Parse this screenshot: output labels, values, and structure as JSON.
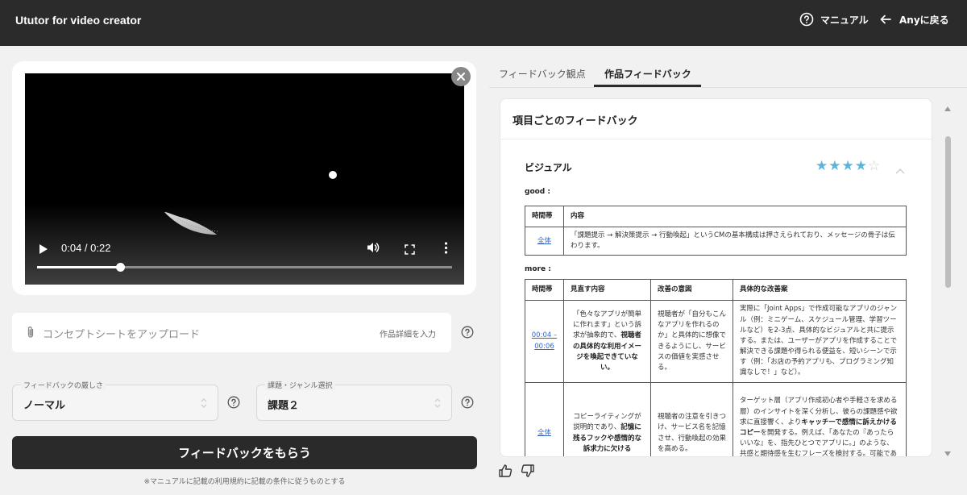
{
  "header": {
    "app_title": "Ututor for video creator",
    "manual_label": "マニュアル",
    "back_label": "Anyに戻る",
    "help_icon": "question-circle-icon",
    "back_icon": "arrow-left-icon"
  },
  "video": {
    "current_time": "0:04",
    "duration": "0:22",
    "time_display": "0:04 / 0:22",
    "progress_fraction": 0.2
  },
  "upload": {
    "label": "コンセプトシートをアップロード",
    "detail_link": "作品詳細を入力"
  },
  "feedback_strictness": {
    "label": "フィードバックの厳しさ",
    "value": "ノーマル"
  },
  "task_select": {
    "label": "課題・ジャンル選択",
    "value": "課題２"
  },
  "submit_button": "フィードバックをもらう",
  "disclaimer": "※マニュアルに記載の利用規約に記載の条件に従うものとする",
  "tabs": [
    {
      "label": "フィードバック観点",
      "active": false
    },
    {
      "label": "作品フィードバック",
      "active": true
    }
  ],
  "feedback_card": {
    "title": "項目ごとのフィードバック",
    "section": {
      "name": "ビジュアル",
      "rating": 4,
      "rating_max": 5,
      "star_color": "#5bb4d9",
      "good_label": "good :",
      "more_label": "more :",
      "good_table": {
        "headers": [
          "時間帯",
          "内容"
        ],
        "rows": [
          {
            "time": "全体",
            "content": "「課題提示 → 解決策提示 → 行動喚起」というCMの基本構成は押さえられており、メッセージの骨子は伝わります。"
          }
        ]
      },
      "more_table": {
        "headers": [
          "時間帯",
          "見直す内容",
          "改善の意図",
          "具体的な改善案"
        ],
        "rows": [
          {
            "time": "00:04 – 00:06",
            "issue_pre": "「色々なアプリが簡単に作れます」という訴求が抽象的で、",
            "issue_bold": "視聴者の具体的な利用イメージを喚起できていない。",
            "intent": "視聴者が「自分もこんなアプリを作れるのか」と具体的に想像できるようにし、サービスの価値を実感させる。",
            "suggestion": "実際に「Joint Apps」で作成可能なアプリのジャンル（例：ミニゲーム、スケジュール管理、学習ツールなど）を2-3点、具体的なビジュアルと共に提示する。または、ユーザーがアプリを作成することで解決できる課題や得られる便益を、短いシーンで示す（例：「お店の予約アプリも、プログラミング知識なしで！」など）。"
          },
          {
            "time": "全体",
            "issue_pre": "コピーライティングが説明的であり、",
            "issue_bold": "記憶に残るフックや感情的な訴求力に欠ける",
            "intent": "視聴者の注意を引きつけ、サービス名を記憶させ、行動喚起の効果を高める。",
            "suggestion_pre": "ターゲット層（アプリ作成初心者や手軽さを求める層）のインサイトを深く分析し、彼らの課題感や欲求に直接響く、より",
            "suggestion_bold": "キャッチーで感情に訴えかけるコピー",
            "suggestion_post": "を開発する。例えば、「あなたの『あったらいいな』を、指先ひとつでアプリに。」のような、共感と期待感を生むフレーズを検討する。可能であれば、複数のコピー案で"
          }
        ]
      }
    }
  },
  "reactions": {
    "like_icon": "thumbs-up-icon",
    "dislike_icon": "thumbs-down-icon"
  }
}
